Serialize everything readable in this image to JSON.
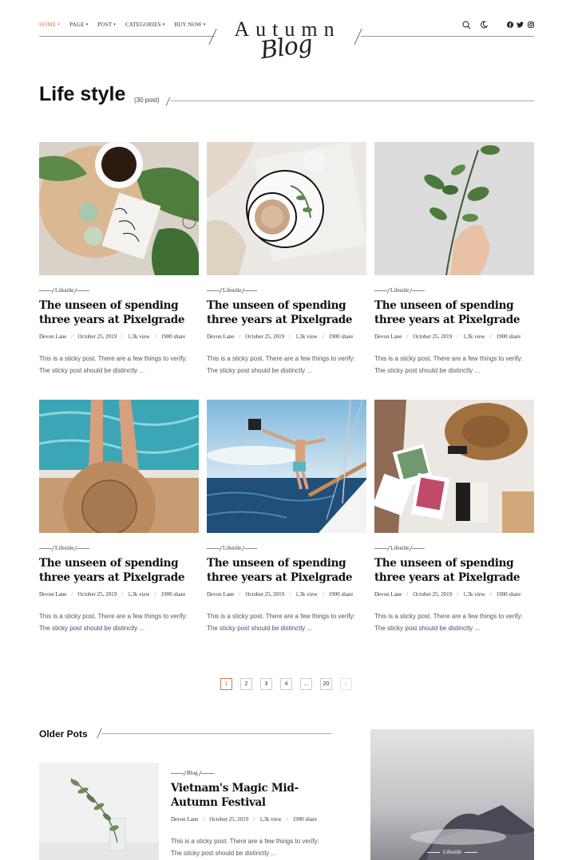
{
  "nav": {
    "items": [
      {
        "label": "HOME",
        "caret": "▾"
      },
      {
        "label": "PAGE",
        "caret": "▾"
      },
      {
        "label": "POST",
        "caret": "▾"
      },
      {
        "label": "CATEGORIES",
        "caret": "▾"
      },
      {
        "label": "BUY NOW",
        "caret": "▾"
      }
    ]
  },
  "logo": {
    "word": "Autumn",
    "script": "Blog"
  },
  "header_icons": [
    "search-icon",
    "moon-icon",
    "facebook-icon",
    "twitter-icon",
    "instagram-icon"
  ],
  "section": {
    "title": "Life style",
    "count": "(30 post)"
  },
  "cards": [
    {
      "category": "Lifestile",
      "title": "The unseen of spending three years at Pixelgrade",
      "author": "Devon Lane",
      "date": "October 25, 2019",
      "views": "1,3k view",
      "shares": "1900 share",
      "excerpt_a": "This is a sticky post. There are a few things to verify: The sticky post should be distinctly ...",
      "excerpt_b": ""
    },
    {
      "category": "Lifestile",
      "title": "The unseen of spending three years at Pixelgrade",
      "author": "Devon Lane",
      "date": "October 25, 2019",
      "views": "1,3k view",
      "shares": "1900 share",
      "excerpt_a": "This is a sticky post. There are a few things to verify: The sticky post should be distinctly ...",
      "excerpt_b": ""
    },
    {
      "category": "Lifestile",
      "title": "The unseen of spending three years at Pixelgrade",
      "author": "Devon Lane",
      "date": "October 25, 2019",
      "views": "1,3k view",
      "shares": "1900 share",
      "excerpt_a": "This is a sticky post. There are a few things to verify: The sticky post should be distinctly ...",
      "excerpt_b": ""
    },
    {
      "category": "Lifestile",
      "title": "The unseen of spending three years at Pixelgrade",
      "author": "Devon Lane",
      "date": "October 25, 2019",
      "views": "1,3k view",
      "shares": "1900 share",
      "excerpt_a": "This is a sticky post. There are a few things to verify: The ",
      "excerpt_b": "sticky post should be distinctly ..."
    },
    {
      "category": "Lifestile",
      "title": "The unseen of spending three years at Pixelgrade",
      "author": "Devon Lane",
      "date": "October 25, 2019",
      "views": "1,3k view",
      "shares": "1900 share",
      "excerpt_a": "This is a sticky post. There are a few things to verify: The ",
      "excerpt_b": "sticky post should be distinctly ..."
    },
    {
      "category": "Lifestile",
      "title": "The unseen of spending three years at Pixelgrade",
      "author": "Devon Lane",
      "date": "October 25, 2019",
      "views": "1,3k view",
      "shares": "1900 share",
      "excerpt_a": "This is a sticky post. There are a few things to verify: The ",
      "excerpt_b": "sticky post should be distinctly ..."
    }
  ],
  "pagination": {
    "pages": [
      "1",
      "2",
      "3",
      "4",
      "...",
      "20"
    ],
    "next": "›",
    "current": "1"
  },
  "older": {
    "title": "Older Pots",
    "post": {
      "category": "Blog",
      "title": "Vietnam's Magic Mid-Autumn Festival",
      "author": "Devon Lane",
      "date": "October 25, 2019",
      "views": "1,3k view",
      "shares": "1900 share",
      "excerpt": "This is a sticky post. There are a few things to verify: The sticky post should be distinctly ..."
    },
    "feature_category": "Lifestile"
  },
  "colors": {
    "accent": "#c9784e",
    "text": "#111111",
    "muted": "#555555"
  }
}
